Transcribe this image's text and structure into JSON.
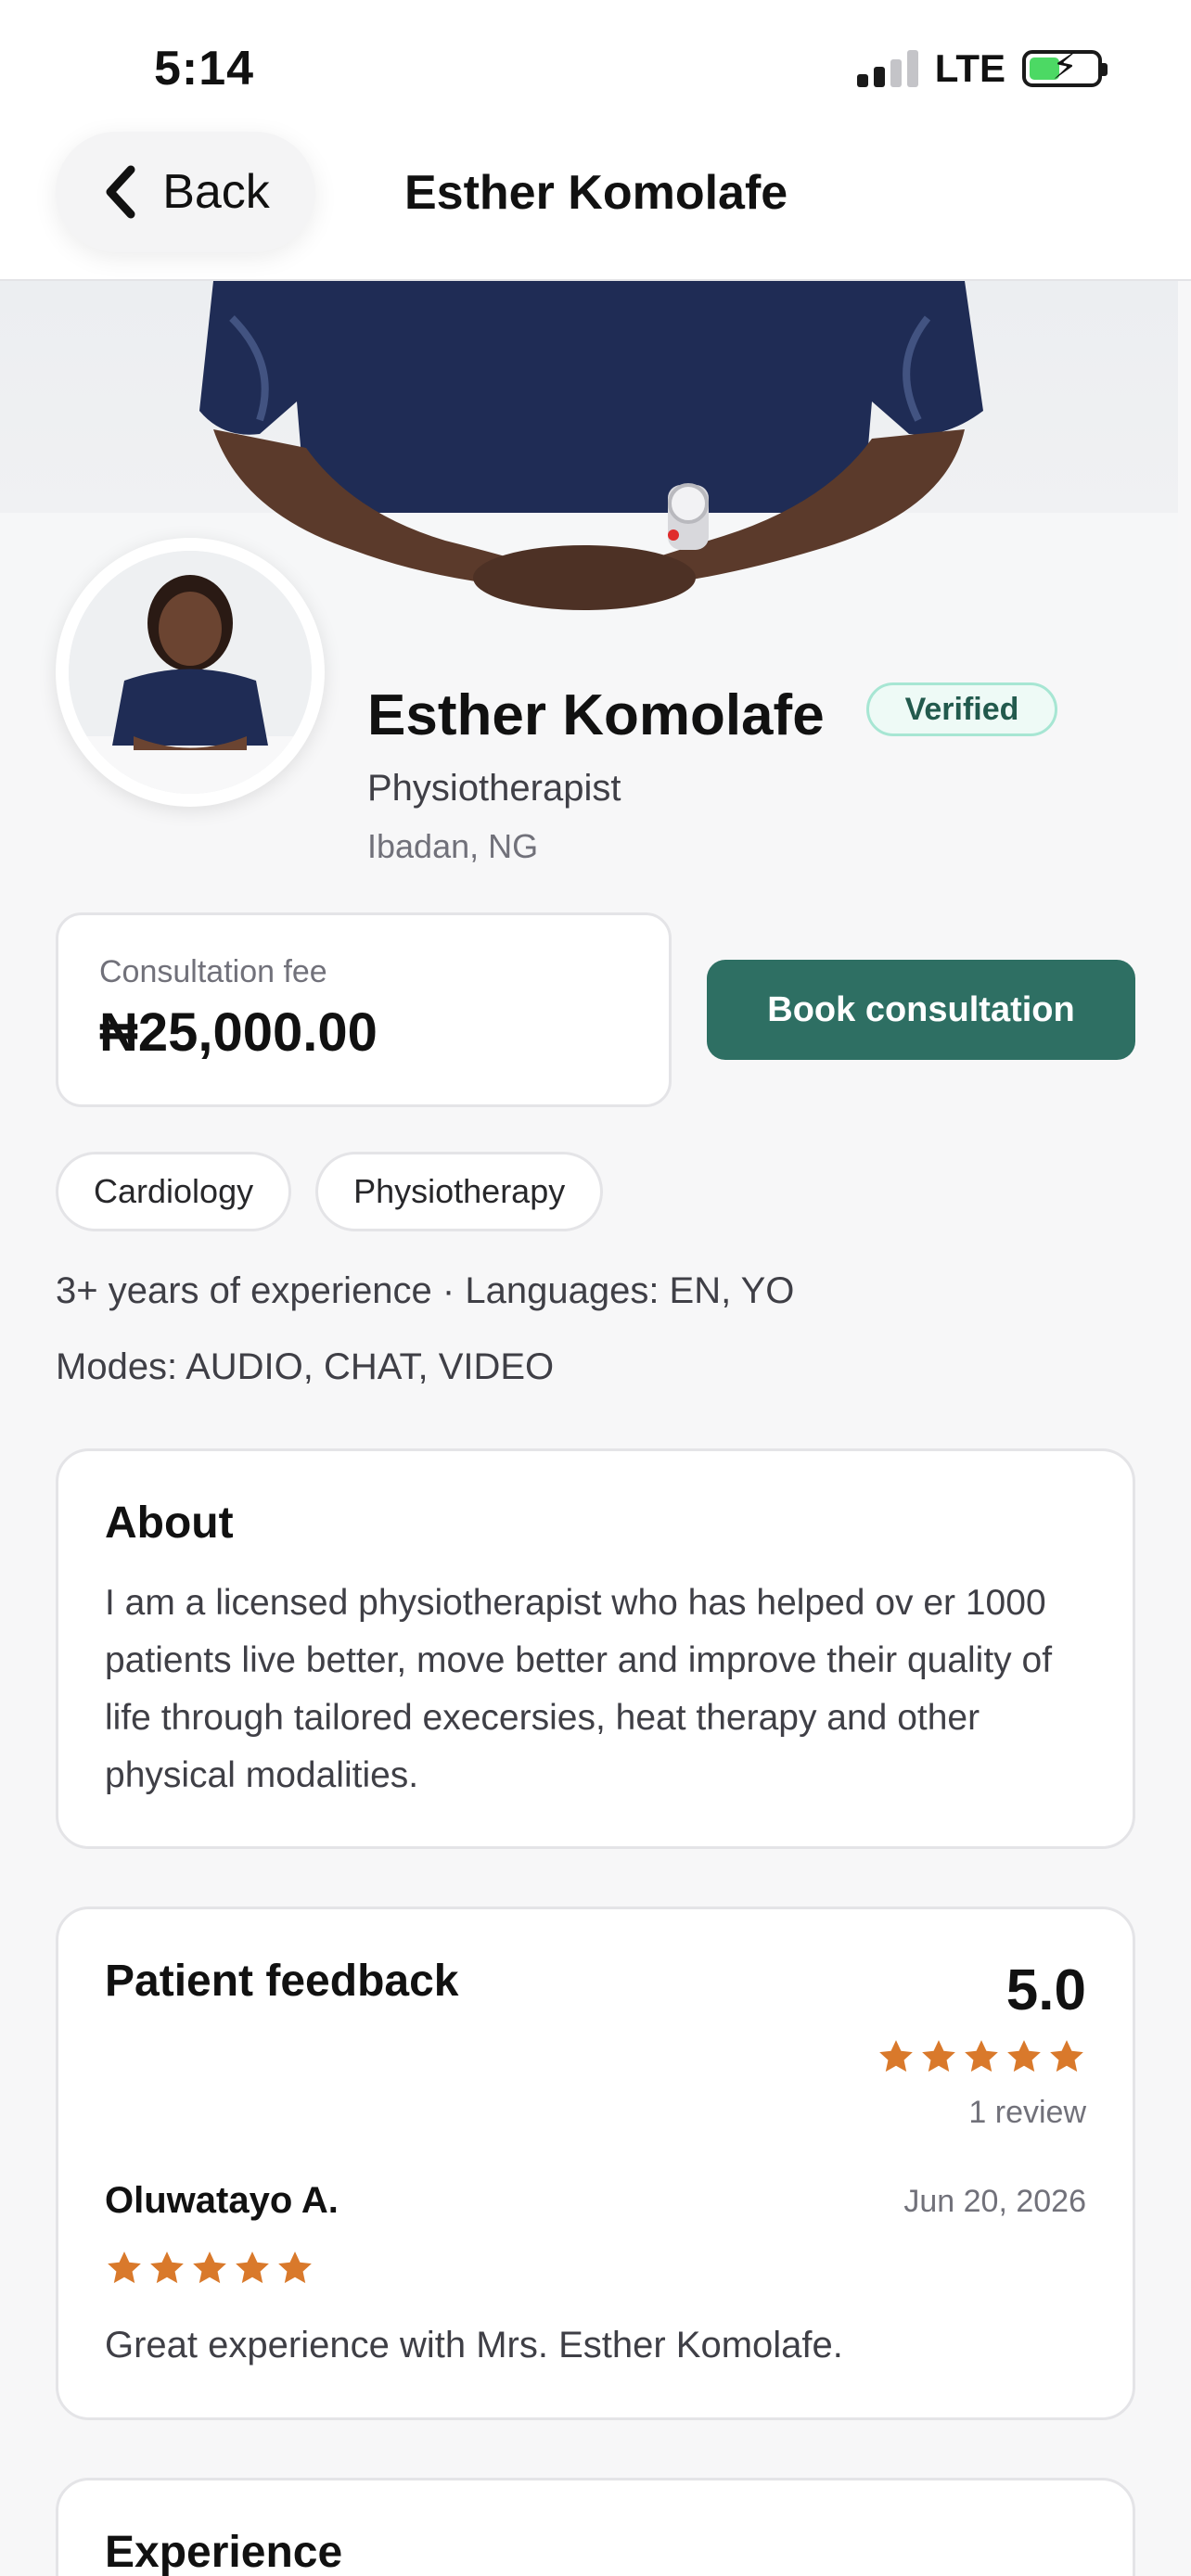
{
  "status_bar": {
    "time": "5:14",
    "network": "LTE"
  },
  "nav": {
    "back_label": "Back",
    "title": "Esther Komolafe"
  },
  "profile": {
    "name": "Esther Komolafe",
    "verified_label": "Verified",
    "specialty": "Physiotherapist",
    "location": "Ibadan, NG"
  },
  "fee": {
    "label": "Consultation fee",
    "amount": "₦25,000.00"
  },
  "book_button": "Book consultation",
  "tags": [
    "Cardiology",
    "Physiotherapy"
  ],
  "meta": {
    "experience_languages": "3+ years of experience · Languages: EN, YO",
    "modes": "Modes: AUDIO, CHAT, VIDEO"
  },
  "about": {
    "title": "About",
    "text": "I am a licensed physiotherapist who has helped ov er 1000 patients live better, move better and improve their quality of life through tailored execersies, heat therapy and other physical modalities."
  },
  "feedback": {
    "title": "Patient feedback",
    "rating": "5.0",
    "rating_stars": 5,
    "review_count": "1 review",
    "reviews": [
      {
        "author": "Oluwatayo A.",
        "date": "Jun 20, 2026",
        "stars": 5,
        "text": "Great experience with Mrs. Esther Komolafe."
      }
    ]
  },
  "experience": {
    "title": "Experience"
  },
  "colors": {
    "accent": "#2e6f63",
    "star": "#d9792b",
    "verified_border": "#a7e6d3",
    "verified_text": "#225a4d"
  },
  "icons": {
    "back": "chevron-left-icon",
    "star": "star-icon",
    "battery": "battery-charging-icon",
    "signal": "cellular-signal-icon"
  }
}
